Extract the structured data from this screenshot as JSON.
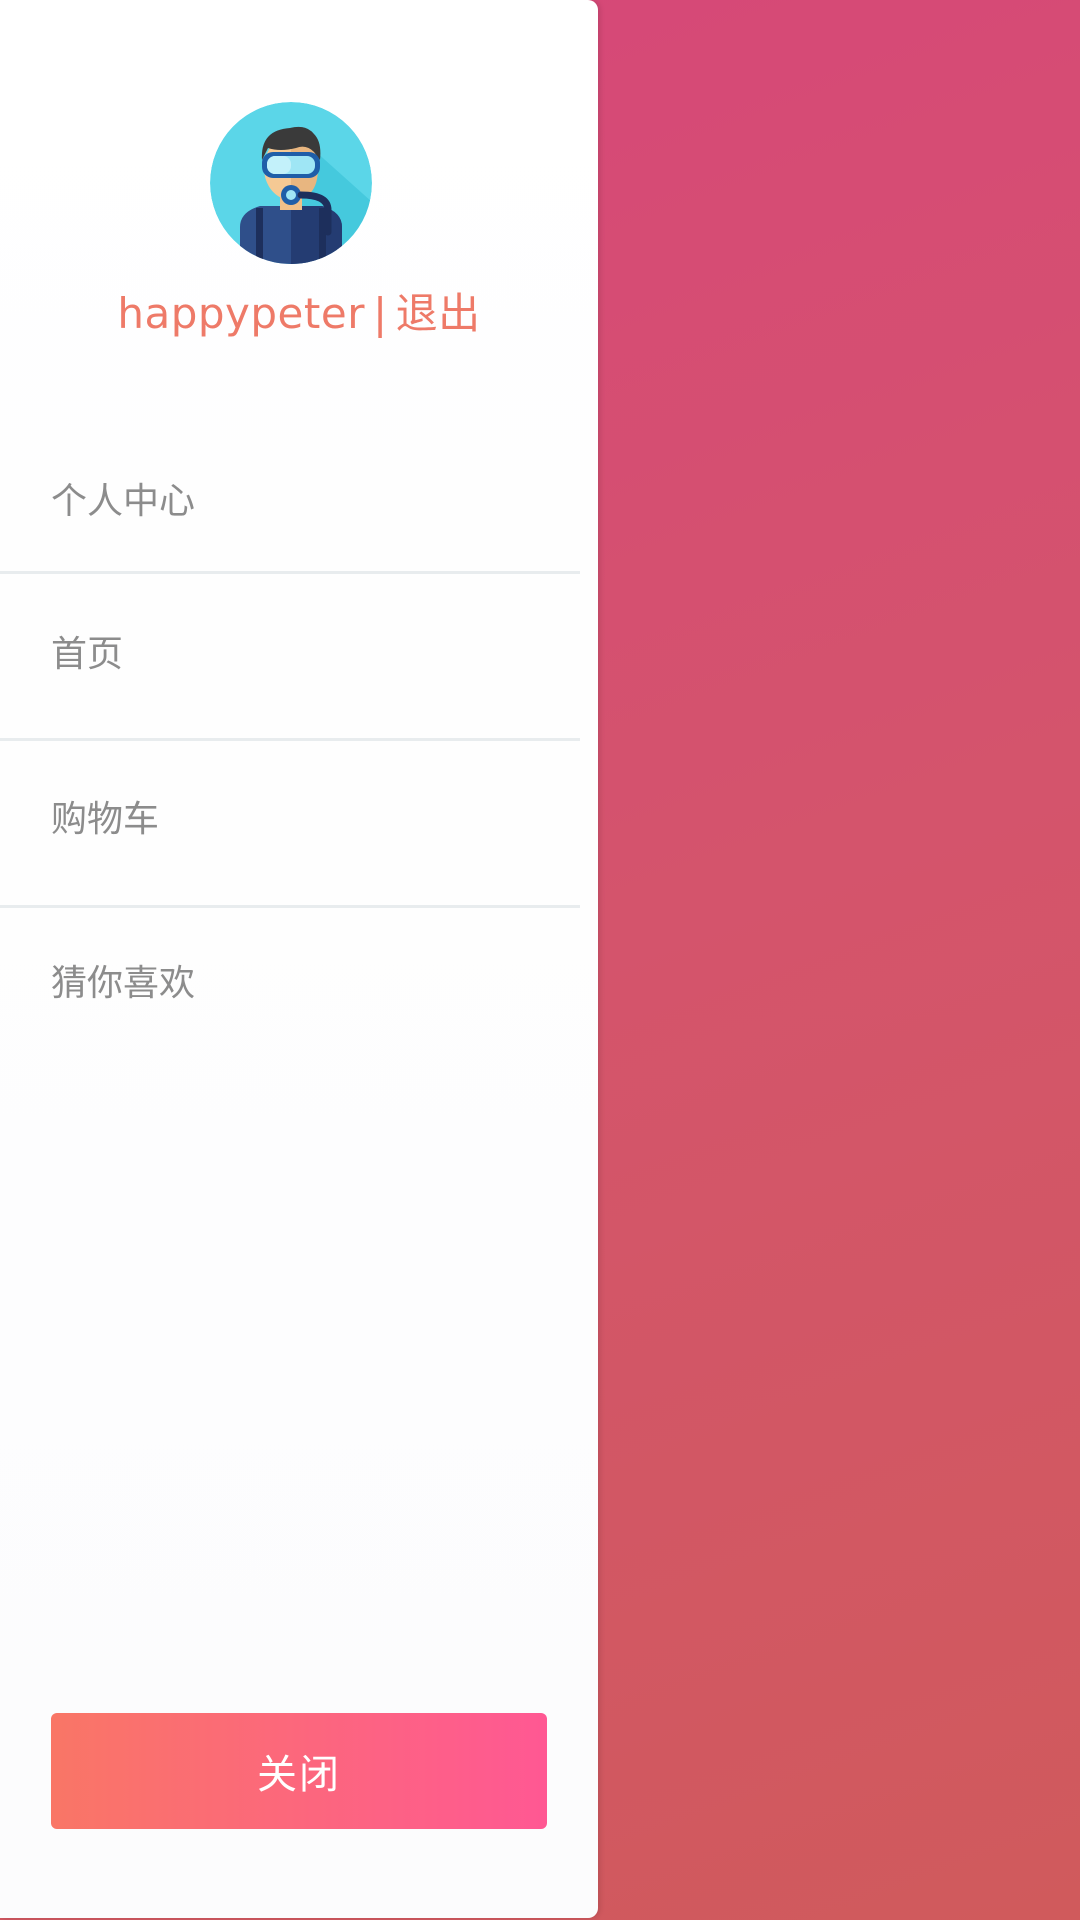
{
  "user": {
    "username": "happypeter",
    "separator": "|",
    "logout_label": "退出"
  },
  "menu": {
    "items": [
      {
        "label": "个人中心"
      },
      {
        "label": "首页"
      },
      {
        "label": "购物车"
      },
      {
        "label": "猜你喜欢"
      }
    ]
  },
  "close_button": {
    "label": "关闭"
  },
  "icons": {
    "avatar": "scuba-diver-avatar-icon"
  },
  "colors": {
    "accent_text": "#ee7a68",
    "menu_text": "#8c8c8c",
    "button_gradient_start": "#f97666",
    "button_gradient_end": "#ff5893",
    "overlay_top": "#d7467a",
    "overlay_bottom": "#d05a5c"
  }
}
